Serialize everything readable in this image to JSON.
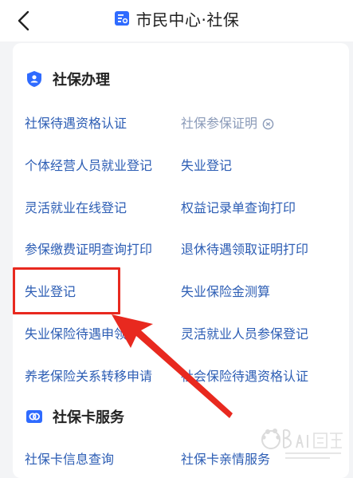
{
  "header": {
    "title": "市民中心·社保",
    "back_icon": "chevron-left-icon",
    "title_icon": "document-badge-icon",
    "accent": "#2f6bff"
  },
  "sections": {
    "social_insurance": {
      "title": "社保办理",
      "icon": "shield-user-icon",
      "items": [
        "社保待遇资格认证",
        "社保参保证明",
        "个体经营人员就业登记",
        "失业登记",
        "灵活就业在线登记",
        "权益记录单查询打印",
        "参保缴费证明查询打印",
        "退休待遇领取证明打印",
        "失业登记",
        "失业保险金测算",
        "失业保险待遇申领",
        "灵活就业人员参保登记",
        "养老保险关系转移申请",
        "社会保险待遇资格认证"
      ]
    },
    "card_service": {
      "title": "社保卡服务",
      "icon": "card-icon",
      "items": [
        "社保卡信息查询",
        "社保卡亲情服务"
      ]
    }
  },
  "colors": {
    "link": "#2c5db4",
    "disabled_link": "#8a9ab8",
    "highlight": "#e8291f"
  }
}
